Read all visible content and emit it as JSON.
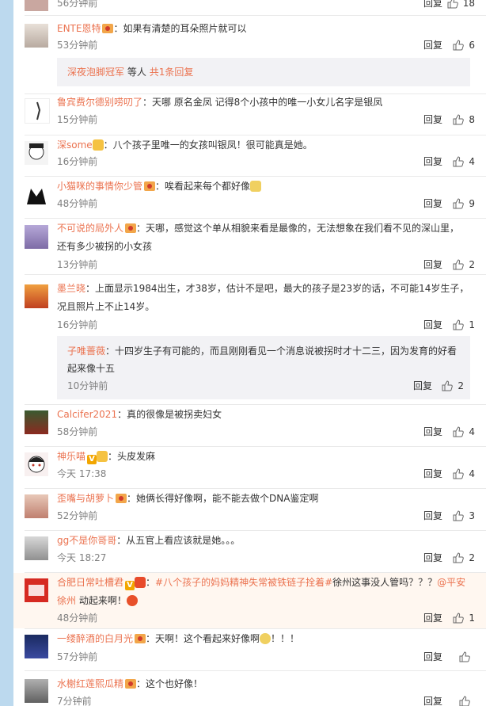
{
  "comments": [
    {
      "id": "c0",
      "text": "",
      "time": "56分钟前",
      "reply": "回复",
      "likes": "18"
    },
    {
      "id": "c1",
      "user": "ENTE恩特",
      "text": "如果有清楚的耳朵照片就可以",
      "time": "53分钟前",
      "reply": "回复",
      "likes": "6",
      "sub": {
        "user": "深夜泡脚冠军",
        "mid": "等人",
        "count": "共1条回复"
      }
    },
    {
      "id": "c2",
      "user": "鲁宾费尔德别唠叨了",
      "text": "天哪 原名金凤 记得8个小孩中的唯一小女儿名字是银凤",
      "time": "15分钟前",
      "reply": "回复",
      "likes": "8"
    },
    {
      "id": "c3",
      "user": "深some",
      "text": "八个孩子里唯一的女孩叫银凤！很可能真是她。",
      "time": "16分钟前",
      "reply": "回复",
      "likes": "4"
    },
    {
      "id": "c4",
      "user": "小猫咪的事情你少管",
      "text": "唉看起来每个都好像",
      "time": "48分钟前",
      "reply": "回复",
      "likes": "9"
    },
    {
      "id": "c5",
      "user": "不可说的局外人",
      "text": "天哪，感觉这个单从相貌来看是最像的，无法想象在我们看不见的深山里，",
      "text2": "还有多少被拐的小女孩",
      "time": "13分钟前",
      "reply": "回复",
      "likes": "2"
    },
    {
      "id": "c6",
      "user": "墨兰晓",
      "text": "上面显示1984出生，才38岁，估计不是吧，最大的孩子是23岁的话，不可能14岁生子，",
      "text2": "况且照片上不止14岁。",
      "time": "16分钟前",
      "reply": "回复",
      "likes": "1",
      "sub": {
        "user": "子唯蔷薇",
        "text": "十四岁生子有可能的，而且刚刚看见一个消息说被拐时才十二三，因为发育的好看",
        "text2": "起来像十五",
        "time": "10分钟前",
        "reply": "回复",
        "likes": "2"
      }
    },
    {
      "id": "c7",
      "user": "Calcifer2021",
      "text": "真的很像是被拐卖妇女",
      "time": "58分钟前",
      "reply": "回复",
      "likes": "4"
    },
    {
      "id": "c8",
      "user": "神乐喵",
      "text": "头皮发麻",
      "time": "今天 17:38",
      "reply": "回复",
      "likes": "4"
    },
    {
      "id": "c9",
      "user": "歪嘴与胡萝卜",
      "text": "她俩长得好像啊，能不能去做个DNA鉴定啊",
      "time": "52分钟前",
      "reply": "回复",
      "likes": "3"
    },
    {
      "id": "c10",
      "user": "gg不是你哥哥",
      "text": "从五官上看应该就是她。。。",
      "time": "今天 18:27",
      "reply": "回复",
      "likes": "2"
    },
    {
      "id": "c11",
      "user": "合肥日常吐槽君",
      "tag": "#八个孩子的妈妈精神失常被铁链子拴着#",
      "text": "徐州这事没人管吗？？？",
      "mention": "@平安",
      "mention2": "徐州",
      "text2": "动起来啊！",
      "time": "48分钟前",
      "reply": "回复",
      "likes": "1"
    },
    {
      "id": "c12",
      "user": "一缕醉酒的白月光",
      "text": "天啊！这个看起来好像啊",
      "text_end": "！！！",
      "time": "57分钟前",
      "reply": "回复",
      "likes": ""
    },
    {
      "id": "c13",
      "user": "水榭红莲熙瓜精",
      "text": "这个也好像！",
      "time": "7分钟前",
      "reply": "回复",
      "likes": ""
    }
  ],
  "colors": {
    "accent": "#eb7350",
    "background": "#bcd9ee"
  },
  "icons": {
    "like": "thumbs-up-icon",
    "vip": "vip-badge-icon"
  }
}
